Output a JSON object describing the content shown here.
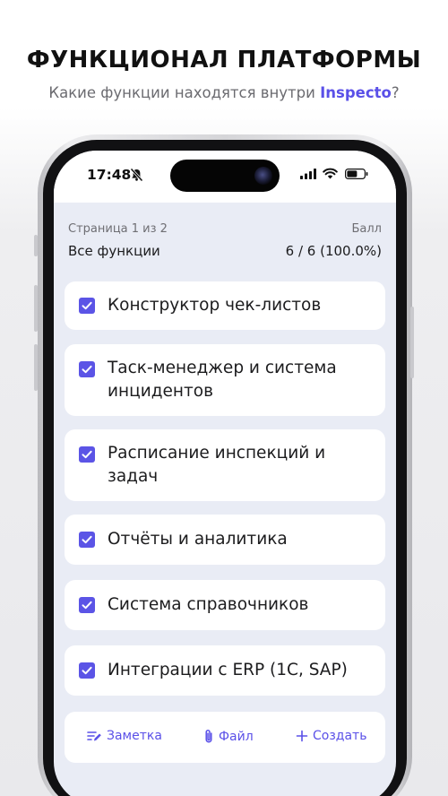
{
  "promo": {
    "title": "ФУНКЦИОНАЛ ПЛАТФОРМЫ",
    "subtitle_prefix": "Какие функции находятся внутри ",
    "subtitle_brand": "Inspecto",
    "subtitle_suffix": "?"
  },
  "status_bar": {
    "time": "17:48",
    "icons": [
      "bell-slash-icon",
      "signal-icon",
      "wifi-icon",
      "battery-icon"
    ]
  },
  "header": {
    "pager": "Страница 1 из 2",
    "score_label": "Балл",
    "filter": "Все функции",
    "score_value": "6 / 6 (100.0%)"
  },
  "checklist": {
    "items": [
      {
        "label": "Конструктор чек-листов",
        "checked": true
      },
      {
        "label": "Таск-менеджер и система инцидентов",
        "checked": true
      },
      {
        "label": "Расписание инспекций и задач",
        "checked": true
      },
      {
        "label": "Отчёты и аналитика",
        "checked": true
      },
      {
        "label": "Система справочников",
        "checked": true
      },
      {
        "label": "Интеграции с ERP (1С, SAP)",
        "checked": true
      }
    ]
  },
  "actions": {
    "note": "Заметка",
    "file": "Файл",
    "create": "Создать"
  },
  "colors": {
    "accent": "#5b54e6",
    "screen_bg": "#e9ecf5",
    "card_bg": "#ffffff"
  }
}
